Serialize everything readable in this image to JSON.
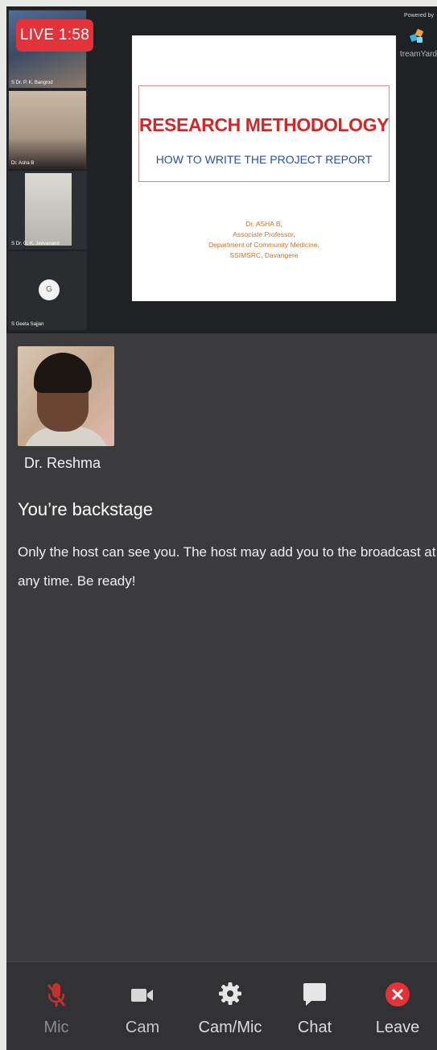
{
  "live": {
    "label": "LIVE 1:58"
  },
  "participants": [
    {
      "name": "S Dr. P. K. Bangrod"
    },
    {
      "name": "Dr. Asha B"
    },
    {
      "name": "S Dr. G. K. Jeevanand"
    },
    {
      "name": "S Geeta Sajjan",
      "avatar_initial": "G"
    }
  ],
  "slide": {
    "title": "RESEARCH METHODOLOGY",
    "subtitle": "HOW TO WRITE THE PROJECT REPORT",
    "author_lines": [
      "Dr. ASHA B,",
      "Associate Professor,",
      "Department of Community Medicine,",
      "SSIMSRC, Davangere"
    ]
  },
  "branding": {
    "powered_by": "Powered by",
    "logo_text_partial": "treamYard"
  },
  "self_camera": {
    "name": "Dr. Reshma"
  },
  "backstage": {
    "title": "You’re backstage",
    "message": "Only the host can see you. The host may add you to the broadcast at any time. Be ready!"
  },
  "toolbar": {
    "buttons": [
      {
        "label": "Mic",
        "icon": "mic-muted-icon"
      },
      {
        "label": "Cam",
        "icon": "camera-icon"
      },
      {
        "label": "Cam/Mic",
        "icon": "gear-icon"
      },
      {
        "label": "Chat",
        "icon": "chat-icon"
      },
      {
        "label": "Leave",
        "icon": "leave-icon"
      }
    ]
  },
  "colors": {
    "live_badge": "#e2333b",
    "slide_title": "#cc2a2a",
    "slide_subtitle": "#2d4f9a",
    "leave": "#e2333b",
    "panel": "#3b3b3d"
  }
}
